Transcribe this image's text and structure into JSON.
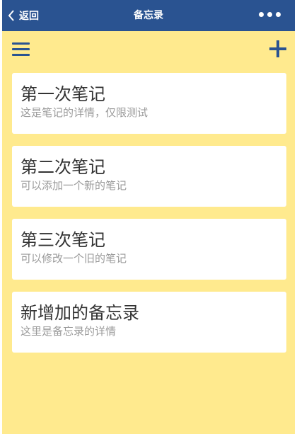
{
  "navbar": {
    "back_label": "返回",
    "title": "备忘录",
    "more_icon": "more-dots-icon"
  },
  "toolbar": {
    "menu_icon": "hamburger-menu-icon",
    "add_icon": "plus-icon"
  },
  "notes": [
    {
      "title": "第一次笔记",
      "detail": "这是笔记的详情，仅限测试"
    },
    {
      "title": "第二次笔记",
      "detail": "可以添加一个新的笔记"
    },
    {
      "title": "第三次笔记",
      "detail": "可以修改一个旧的笔记"
    },
    {
      "title": "新增加的备忘录",
      "detail": "这里是备忘录的详情"
    }
  ],
  "colors": {
    "navbar_bg": "#2a5391",
    "page_bg": "#ffea8e",
    "card_bg": "#ffffff",
    "title_text": "#333333",
    "detail_text": "#9a9a9a"
  }
}
